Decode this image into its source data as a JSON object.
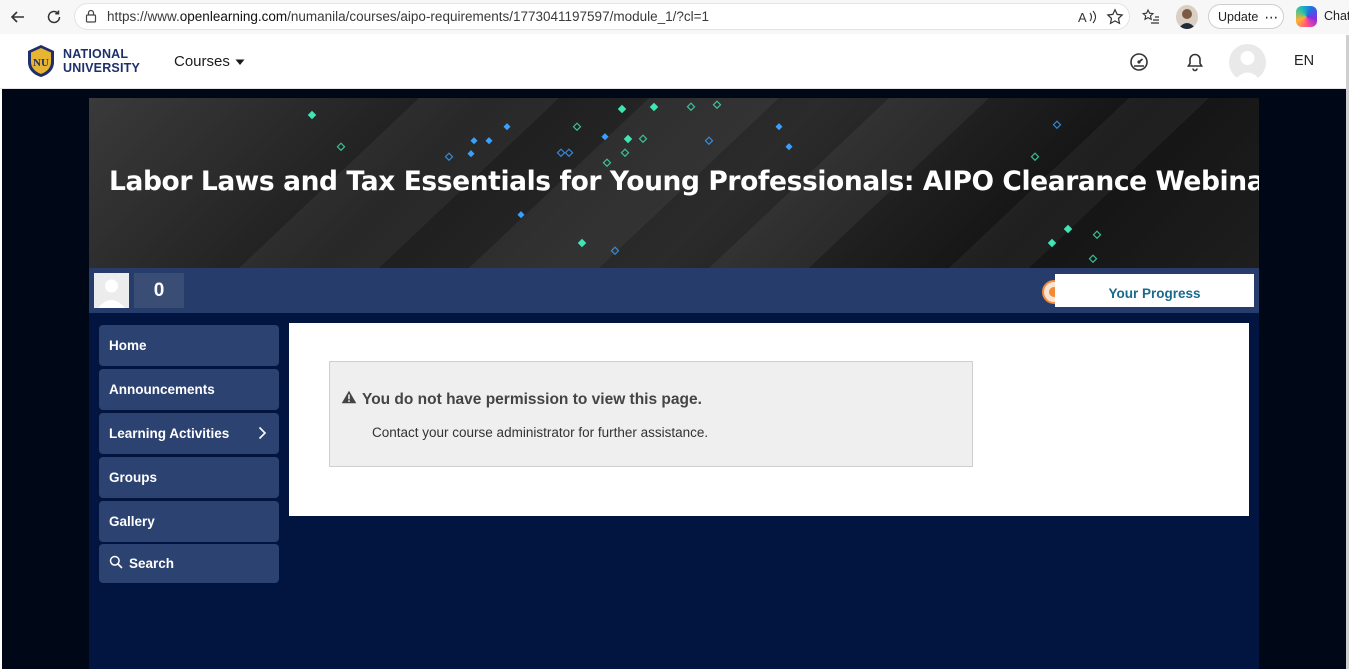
{
  "browser": {
    "url_prefix": "https://www.",
    "url_host": "openlearning.com",
    "url_path": "/numanila/courses/aipo-requirements/1773041197597/module_1/?cl=1",
    "update_label": "Update",
    "chat_label": "Chat"
  },
  "header": {
    "logo_line1": "NATIONAL",
    "logo_line2": "UNIVERSITY",
    "courses_label": "Courses",
    "language": "EN"
  },
  "banner": {
    "title": "Labor Laws and Tax Essentials for Young Professionals: AIPO Clearance Webinars"
  },
  "progress": {
    "points": "0",
    "your_progress_label": "Your Progress"
  },
  "sidebar": {
    "items": [
      {
        "label": "Home"
      },
      {
        "label": "Announcements"
      },
      {
        "label": "Learning Activities"
      },
      {
        "label": "Groups"
      },
      {
        "label": "Gallery"
      },
      {
        "label": "Search"
      }
    ]
  },
  "alert": {
    "title": "You do not have permission to view this page.",
    "message": "Contact your course administrator for further assistance."
  },
  "colors": {
    "page_background": "#000817",
    "content_background": "#011540",
    "menu_item": "#2c4270",
    "progress_strip": "#263d6b",
    "progress_accent": "#f08b3a",
    "progress_text": "#1a6a8e"
  }
}
